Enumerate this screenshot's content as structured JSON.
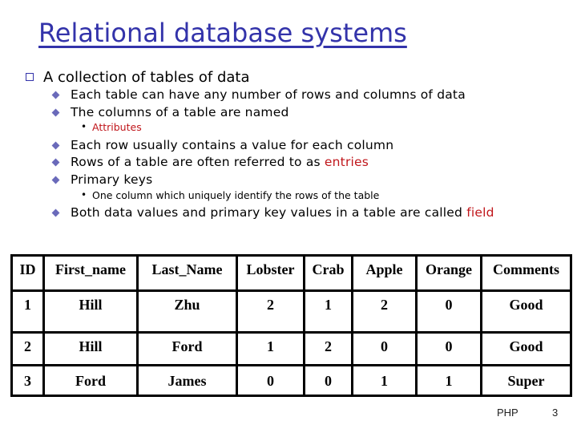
{
  "slide": {
    "title": "Relational database systems",
    "bullets": {
      "main": "A collection of tables of data",
      "sub1": "Each table can have any number of rows and columns of data",
      "sub2": "The columns of a table are named",
      "sub2_detail": "Attributes",
      "sub3": "Each row usually contains a value for each column",
      "sub4_prefix": "Rows of a table are often referred to as ",
      "sub4_highlight": "entries",
      "sub5": "Primary keys",
      "sub5_detail": "One column which uniquely identify the rows of the table",
      "sub6_prefix": "Both data values and primary key values in a table are called ",
      "sub6_highlight": "field"
    },
    "table": {
      "headers": [
        "ID",
        "First_name",
        "Last_Name",
        "Lobster",
        "Crab",
        "Apple",
        "Orange",
        "Comments"
      ],
      "rows": [
        [
          "1",
          "Hill",
          "Zhu",
          "2",
          "1",
          "2",
          "0",
          "Good"
        ],
        [
          "2",
          "Hill",
          "Ford",
          "1",
          "2",
          "0",
          "0",
          "Good"
        ],
        [
          "3",
          "Ford",
          "James",
          "0",
          "0",
          "1",
          "1",
          "Super"
        ]
      ]
    },
    "footer": {
      "label": "PHP",
      "page_number": "3"
    },
    "colors": {
      "title": "#3333aa",
      "highlight": "#c0161b",
      "bullet": "#6a6aba"
    }
  }
}
